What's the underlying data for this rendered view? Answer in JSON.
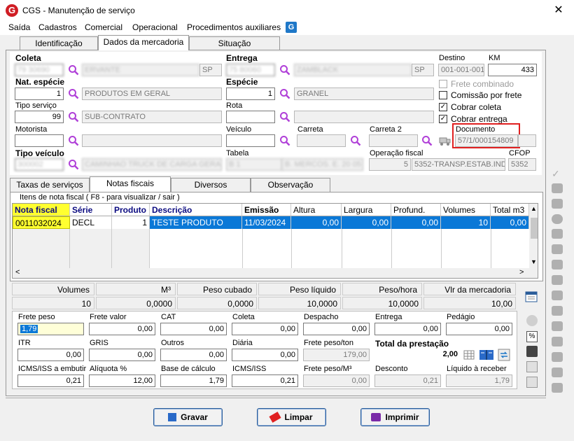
{
  "window": {
    "title": "CGS - Manutenção de serviço",
    "app_icon": "G"
  },
  "menu": [
    "Saída",
    "Cadastros",
    "Comercial",
    "Operacional",
    "Procedimentos auxiliares"
  ],
  "menu_badge": "G",
  "top_tabs": [
    "Identificação",
    "Dados da mercadoria",
    "Situação"
  ],
  "form": {
    "coleta_label": "Coleta",
    "coleta_code": "79 30690",
    "coleta_name": "ERVANTE",
    "coleta_uf": "SP",
    "entrega_label": "Entrega",
    "entrega_code": "75 80060",
    "entrega_name": "ZAMBLACK",
    "entrega_uf": "SP",
    "destino_label": "Destino",
    "destino_value": "001-001-001",
    "km_label": "KM",
    "km_value": "433",
    "nat_especie_label": "Nat. espécie",
    "nat_especie_code": "1",
    "nat_especie_name": "PRODUTOS EM GERAL",
    "especie_label": "Espécie",
    "especie_code": "1",
    "especie_name": "GRANEL",
    "tipo_servico_label": "Tipo serviço",
    "tipo_servico_code": "99",
    "tipo_servico_name": "SUB-CONTRATO",
    "rota_label": "Rota",
    "rota_code": "",
    "rota_name": "",
    "motorista_label": "Motorista",
    "motorista_code": "",
    "motorista_name": "",
    "veiculo_label": "Veículo",
    "veiculo_value": "",
    "carreta_label": "Carreta",
    "carreta_value": "",
    "carreta2_label": "Carreta 2",
    "carreta2_value": "",
    "documento_label": "Documento",
    "documento_value": "57/1/000154809",
    "tipo_veiculo_label": "Tipo veículo",
    "tipo_veiculo_code": "300002",
    "tipo_veiculo_name": "CAMINHAO TRUCK DE CARGA GERAL",
    "tabela_label": "Tabela",
    "tabela_code": "B 1",
    "tabela_name": "B. MERCOS. E. 20 05 2024",
    "operacao_label": "Operação fiscal",
    "operacao_code": "5",
    "operacao_name": "5352-TRANSP.ESTAB.IND",
    "cfop_label": "CFOP",
    "cfop_value": "5352"
  },
  "checks": [
    {
      "label": "Frete combinado",
      "checked": false,
      "disabled": true
    },
    {
      "label": "Comissão por frete",
      "checked": false,
      "disabled": false
    },
    {
      "label": "Cobrar coleta",
      "checked": true,
      "disabled": false
    },
    {
      "label": "Cobrar entrega",
      "checked": true,
      "disabled": false
    }
  ],
  "sub_tabs": [
    "Taxas de serviços",
    "Notas fiscais",
    "Diversos",
    "Observação"
  ],
  "group_title": "Itens de nota fiscal ( F8 - para visualizar / sair )",
  "grid": {
    "headers": [
      "Nota fiscal",
      "Série",
      "Produto",
      "Descrição",
      "Emissão",
      "Altura",
      "Largura",
      "Profund.",
      "Volumes",
      "Total m3"
    ],
    "row": [
      "0011032024",
      "DECL",
      "1",
      "TESTE PRODUTO",
      "11/03/2024",
      "0,00",
      "0,00",
      "0,00",
      "10",
      "0,00"
    ]
  },
  "totals": {
    "headers": [
      "Volumes",
      "M³",
      "Peso cubado",
      "Peso líquido",
      "Peso/hora",
      "Vlr da mercadoria"
    ],
    "values": [
      "10",
      "0,0000",
      "0,0000",
      "10,0000",
      "10,0000",
      "10,00"
    ]
  },
  "freight": {
    "row1": [
      {
        "label": "Frete peso",
        "value": "1,79"
      },
      {
        "label": "Frete valor",
        "value": "0,00"
      },
      {
        "label": "CAT",
        "value": "0,00"
      },
      {
        "label": "Coleta",
        "value": "0,00"
      },
      {
        "label": "Despacho",
        "value": "0,00"
      },
      {
        "label": "Entrega",
        "value": "0,00"
      },
      {
        "label": "Pedágio",
        "value": "0,00"
      }
    ],
    "row2": [
      {
        "label": "ITR",
        "value": "0,00"
      },
      {
        "label": "GRIS",
        "value": "0,00"
      },
      {
        "label": "Outros",
        "value": "0,00"
      },
      {
        "label": "Diária",
        "value": "0,00"
      },
      {
        "label": "Frete peso/ton",
        "value": "179,00"
      },
      {
        "label": "Total da prestação",
        "value": "2,00"
      }
    ],
    "row3": [
      {
        "label": "ICMS/ISS a embutir",
        "value": "0,21"
      },
      {
        "label": "Alíquota %",
        "value": "12,00"
      },
      {
        "label": "Base de cálculo",
        "value": "1,79"
      },
      {
        "label": "ICMS/ISS",
        "value": "0,21"
      },
      {
        "label": "Frete peso/M³",
        "value": "0,00"
      },
      {
        "label": "Desconto",
        "value": "0,21"
      },
      {
        "label": "Líquido à receber",
        "value": "1,79"
      }
    ]
  },
  "buttons": {
    "gravar": "Gravar",
    "limpar": "Limpar",
    "imprimir": "Imprimir"
  },
  "colors": {
    "accent": "#0a78d7",
    "highlight_yellow": "#ffff30",
    "doc_border": "#e02020",
    "brand_red": "#d01d24"
  }
}
